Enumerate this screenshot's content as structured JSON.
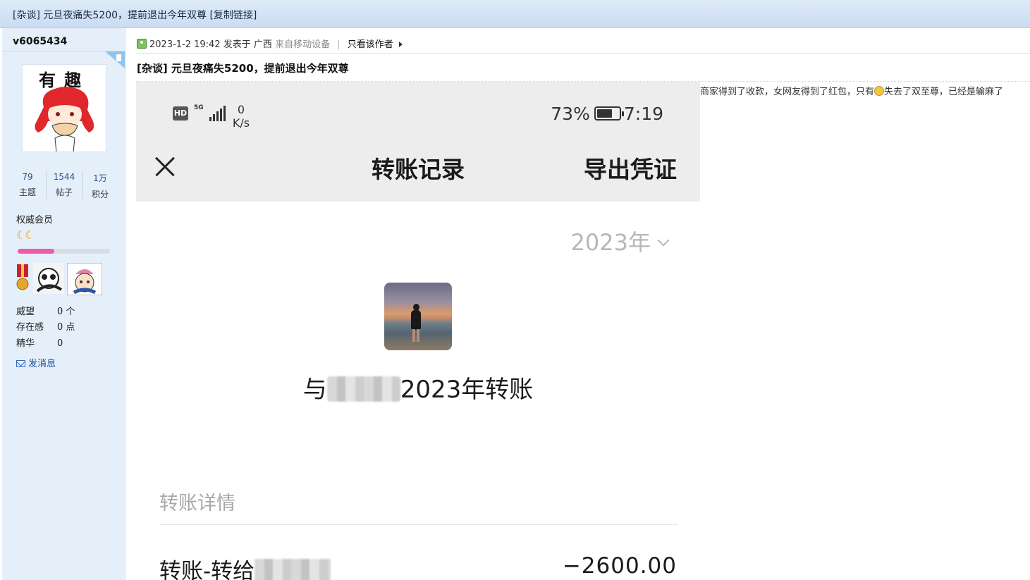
{
  "window": {
    "title": "[杂谈] 元旦夜痛失5200，提前退出今年双尊",
    "copy_link": "[复制链接]"
  },
  "sidebar": {
    "username": "v6065434",
    "avatar_caption": "有趣",
    "stats": [
      {
        "value": "79",
        "label": "主题"
      },
      {
        "value": "1544",
        "label": "帖子"
      },
      {
        "value": "1万",
        "label": "积分"
      }
    ],
    "rank": "权威会员",
    "rank_level_progress": 0.4,
    "reputation_label": "威望",
    "reputation_value": "0 个",
    "presence_label": "存在感",
    "presence_value": "0 点",
    "essence_label": "精华",
    "essence_value": "0",
    "send_message": "发消息"
  },
  "post": {
    "datetime": "2023-1-2 19:42",
    "posted_at": "发表于",
    "location": "广西",
    "from_device": "来自移动设备",
    "only_author": "只看该作者",
    "title": "[杂谈] 元旦夜痛失5200，提前退出今年双尊",
    "body_before_emoji": "商家得到了收款，女网友得到了红包，只有",
    "body_after_emoji": "失去了双至尊，已经是输麻了"
  },
  "phone": {
    "status": {
      "hd": "HD",
      "signal_type": "5G",
      "net_speed_value": "0",
      "net_speed_unit": "K/s",
      "battery_percent": "73%",
      "battery_level": 0.73,
      "time": "7:19"
    },
    "header_title": "转账记录",
    "export": "导出凭证",
    "year_select": "2023年",
    "with_prefix": "与",
    "with_suffix": "2023年转账",
    "section_title": "转账详情",
    "tx_label": "转账-转给",
    "tx_amount": "−2600.00"
  },
  "colors": {
    "progress_fill": "#ef5aa9",
    "link_blue": "#1b4d9a"
  }
}
